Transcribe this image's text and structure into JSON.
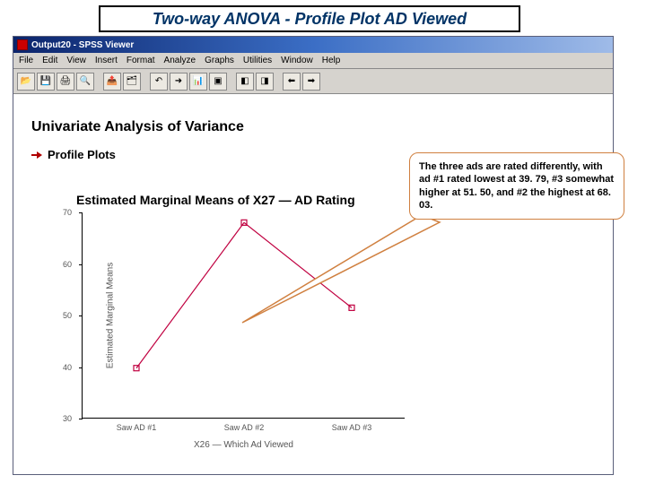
{
  "slide": {
    "title": "Two-way ANOVA - Profile Plot AD Viewed"
  },
  "window": {
    "title": "Output20 - SPSS Viewer"
  },
  "menu": {
    "file": "File",
    "edit": "Edit",
    "view": "View",
    "insert": "Insert",
    "format": "Format",
    "analyze": "Analyze",
    "graphs": "Graphs",
    "utilities": "Utilities",
    "window": "Window",
    "help": "Help"
  },
  "content": {
    "heading1": "Univariate Analysis of Variance",
    "heading2": "Profile Plots"
  },
  "callout": {
    "text": "The three ads are rated differently, with ad #1 rated lowest at 39. 79, #3 somewhat higher at 51. 50, and #2 the highest at 68. 03."
  },
  "chart_data": {
    "type": "line",
    "title": "Estimated Marginal Means of X27 — AD Rating",
    "xlabel": "X26 — Which Ad Viewed",
    "ylabel": "Estimated Marginal Means",
    "ylim": [
      30,
      70
    ],
    "yticks": [
      30,
      40,
      50,
      60,
      70
    ],
    "categories": [
      "Saw AD #1",
      "Saw AD #2",
      "Saw AD #3"
    ],
    "values": [
      39.79,
      68.03,
      51.5
    ]
  }
}
